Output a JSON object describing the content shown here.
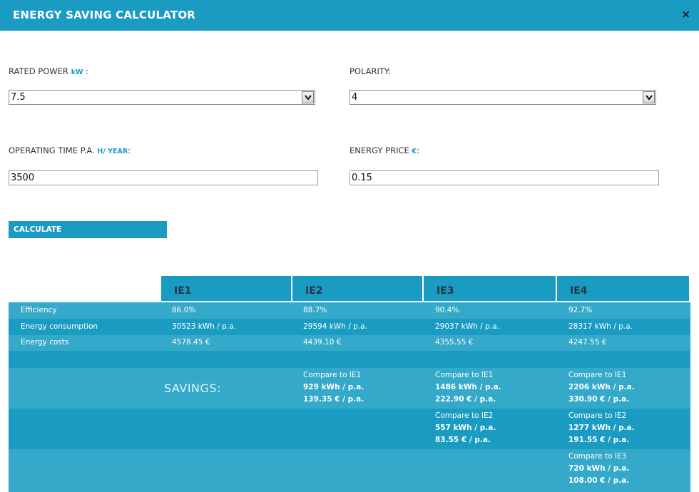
{
  "header": {
    "title": "ENERGY SAVING CALCULATOR",
    "close_icon": "×"
  },
  "form": {
    "rated_power": {
      "label": "RATED POWER",
      "unit": "kW",
      "suffix": ":",
      "value": "7.5"
    },
    "polarity": {
      "label": "POLARITY:",
      "value": "4"
    },
    "operating_time": {
      "label": "OPERATING TIME P.A.",
      "unit": "H/ YEAR",
      "suffix": ":",
      "value": "3500"
    },
    "energy_price": {
      "label": "ENERGY PRICE",
      "unit": "€",
      "suffix": ":",
      "value": "0.15"
    },
    "calculate_label": "CALCULATE"
  },
  "table": {
    "columns": [
      "IE1",
      "IE2",
      "IE3",
      "IE4"
    ],
    "rows": [
      {
        "label": "Efficiency",
        "values": [
          "86.0%",
          "88.7%",
          "90.4%",
          "92.7%"
        ]
      },
      {
        "label": "Energy consumption",
        "values": [
          "30523 kWh / p.a.",
          "29594 kWh / p.a.",
          "29037 kWh / p.a.",
          "28317 kWh / p.a."
        ]
      },
      {
        "label": "Energy costs",
        "values": [
          "4578.45 €",
          "4439.10 €",
          "4355.55 €",
          "4247.55 €"
        ]
      }
    ],
    "savings_title": "SAVINGS:",
    "savings": {
      "ie2_vs_ie1": {
        "compare": "Compare to IE1",
        "kwh": "929 kWh / p.a.",
        "cost": "139.35 € / p.a."
      },
      "ie3_vs_ie1": {
        "compare": "Compare to IE1",
        "kwh": "1486 kWh / p.a.",
        "cost": "222.90 € / p.a."
      },
      "ie4_vs_ie1": {
        "compare": "Compare to IE1",
        "kwh": "2206 kWh / p.a.",
        "cost": "330.90 € / p.a."
      },
      "ie3_vs_ie2": {
        "compare": "Compare to IE2",
        "kwh": "557 kWh / p.a.",
        "cost": "83.55 € / p.a."
      },
      "ie4_vs_ie2": {
        "compare": "Compare to IE2",
        "kwh": "1277 kWh / p.a.",
        "cost": "191.55 € / p.a."
      },
      "ie4_vs_ie3": {
        "compare": "Compare to IE3",
        "kwh": "720 kWh / p.a.",
        "cost": "108.00 € / p.a."
      }
    }
  },
  "colors": {
    "accent": "#1a9cc2",
    "row_light": "#35a9c9",
    "row_dark": "#1a9cc2"
  }
}
